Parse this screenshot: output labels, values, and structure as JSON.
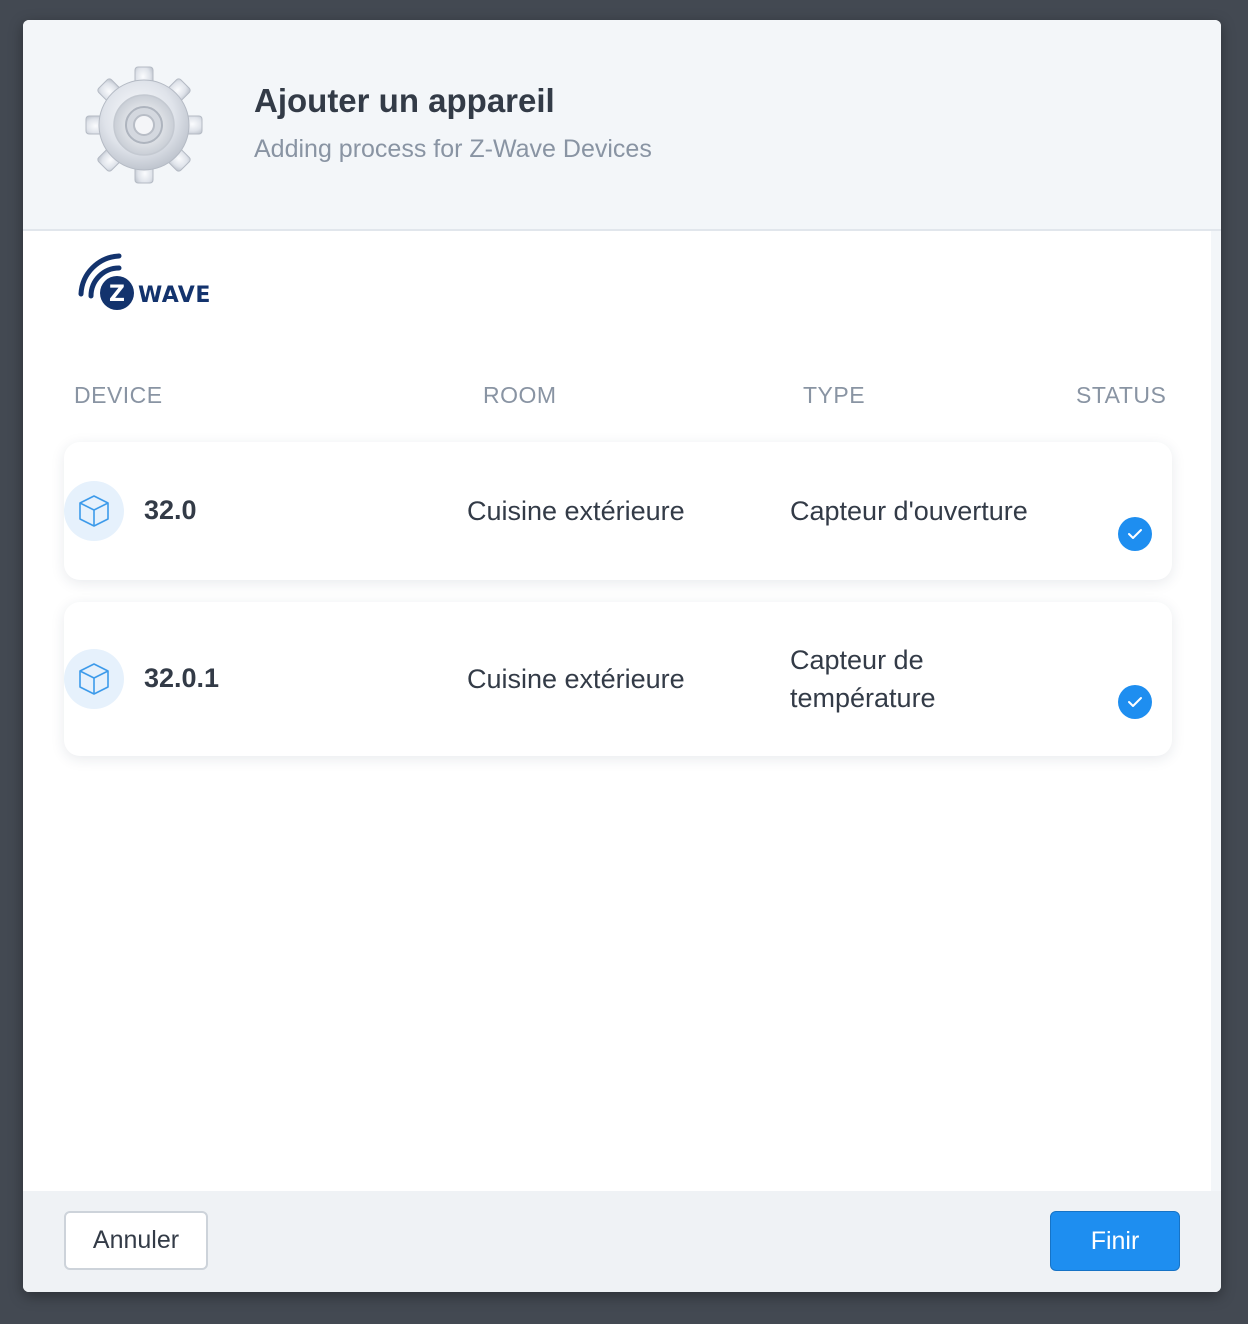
{
  "dialog": {
    "title": "Ajouter un appareil",
    "subtitle": "Adding process for Z-Wave Devices",
    "header_icon": "gear-icon",
    "logo": {
      "icon": "zwave-logo",
      "text": "Z WAVE"
    }
  },
  "table": {
    "columns": [
      "DEVICE",
      "ROOM",
      "TYPE",
      "STATUS"
    ],
    "rows": [
      {
        "icon": "cube-icon",
        "device": "32.0",
        "room": "Cuisine extérieure",
        "type": "Capteur d'ouverture",
        "status": "check-icon"
      },
      {
        "icon": "cube-icon",
        "device": "32.0.1",
        "room": "Cuisine extérieure",
        "type": "Capteur de température",
        "status": "check-icon"
      }
    ]
  },
  "footer": {
    "cancel_label": "Annuler",
    "finish_label": "Finir"
  },
  "colors": {
    "accent": "#1e8ef0",
    "backdrop": "#434952",
    "header_bg": "#f3f6f9",
    "text": "#333b47",
    "muted": "#8994a3",
    "zwave_navy": "#13336d"
  }
}
